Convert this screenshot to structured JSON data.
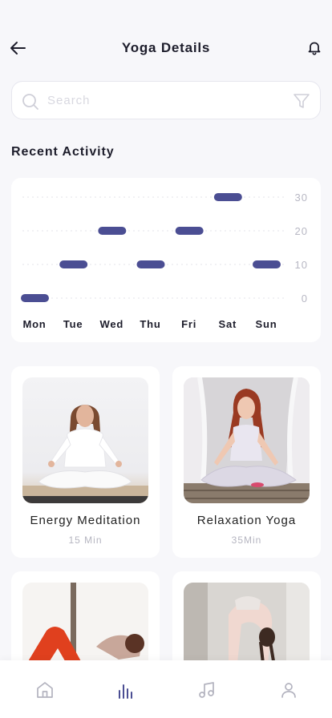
{
  "header": {
    "title": "Yoga Details"
  },
  "search": {
    "placeholder": "Search"
  },
  "recent_activity": {
    "title": "Recent Activity"
  },
  "chart_data": {
    "type": "bar",
    "categories": [
      "Mon",
      "Tue",
      "Wed",
      "Thu",
      "Fri",
      "Sat",
      "Sun"
    ],
    "values": [
      0,
      10,
      20,
      10,
      20,
      30,
      10
    ],
    "y_ticks": [
      0,
      10,
      20,
      30
    ],
    "ylim": [
      0,
      30
    ],
    "grid": true,
    "marker_style": "horizontal-pill",
    "color": "#4b4e93"
  },
  "workouts": [
    {
      "name": "Energy Meditation",
      "duration": "15 Min"
    },
    {
      "name": "Relaxation Yoga",
      "duration": "35Min"
    },
    {
      "name": "",
      "duration": ""
    },
    {
      "name": "",
      "duration": ""
    }
  ],
  "nav": {
    "items": [
      {
        "icon": "home-icon",
        "active": false
      },
      {
        "icon": "stats-icon",
        "active": true
      },
      {
        "icon": "music-icon",
        "active": false
      },
      {
        "icon": "profile-icon",
        "active": false
      }
    ],
    "active_color": "#4b4e93",
    "inactive_color": "#b3b3bf"
  }
}
